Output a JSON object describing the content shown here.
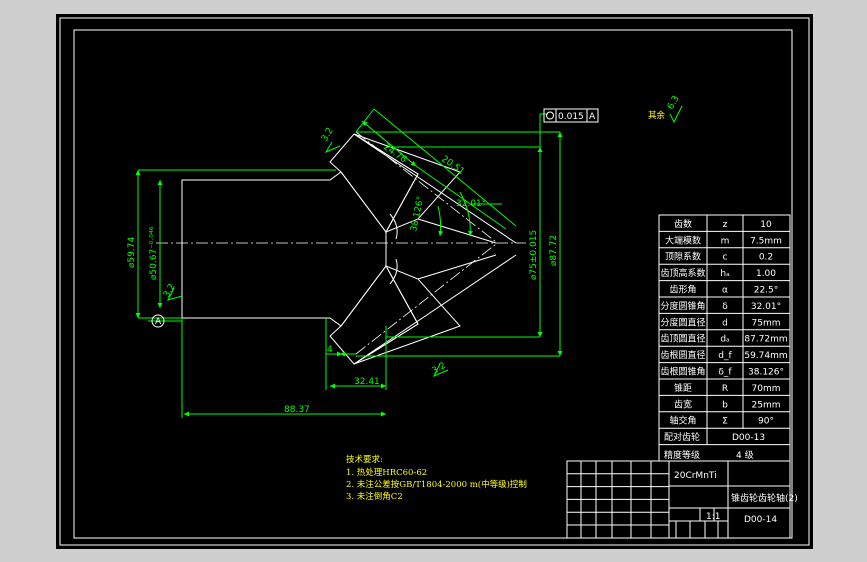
{
  "colors": {
    "sheet": "#000000",
    "outline": "#ffffff",
    "dimension": "#00ff00",
    "notes": "#ffff00"
  },
  "tolerance": {
    "symbol": "circular-runout",
    "value": "0.015",
    "datum": "A"
  },
  "roughness_note": {
    "label": "其余",
    "value": "6.3"
  },
  "dimensions": {
    "d1": "24.76",
    "d2": "20.51",
    "angle": "32.01°",
    "half_angle": "38.126°",
    "dia_root": "⌀59.74",
    "dia_bore": "⌀50.67⁻⁰·⁰⁴⁶",
    "dia_pitch": "⌀75±0.015",
    "dia_tip": "⌀87.72",
    "len_4": "4",
    "len_32": "32.41",
    "len_88": "88.37",
    "rough_a": "3.2",
    "rough_b": "3.2",
    "rough_c": "3.2",
    "datum_label": "A"
  },
  "param_table": [
    {
      "name": "齿数",
      "sym": "z",
      "val": "10"
    },
    {
      "name": "大端模数",
      "sym": "m",
      "val": "7.5mm"
    },
    {
      "name": "顶隙系数",
      "sym": "c",
      "val": "0.2"
    },
    {
      "name": "齿顶高系数",
      "sym": "hₐ",
      "val": "1.00"
    },
    {
      "name": "齿形角",
      "sym": "α",
      "val": "22.5°"
    },
    {
      "name": "分度圆锥角",
      "sym": "δ",
      "val": "32.01°"
    },
    {
      "name": "分度圆直径",
      "sym": "d",
      "val": "75mm"
    },
    {
      "name": "齿顶圆直径",
      "sym": "dₐ",
      "val": "87.72mm"
    },
    {
      "name": "齿根圆直径",
      "sym": "d_f",
      "val": "59.74mm"
    },
    {
      "name": "齿根圆锥角",
      "sym": "δ_f",
      "val": "38.126°"
    },
    {
      "name": "锥距",
      "sym": "R",
      "val": "70mm"
    },
    {
      "name": "齿宽",
      "sym": "b",
      "val": "25mm"
    },
    {
      "name": "轴交角",
      "sym": "Σ",
      "val": "90°"
    }
  ],
  "mating_gear": {
    "label": "配对齿轮",
    "val": "D00-13"
  },
  "accuracy": {
    "label": "精度等级",
    "val": "4 级"
  },
  "notes": {
    "title": "技术要求:",
    "lines": [
      "1. 热处理HRC60-62",
      "2. 未注公差按GB/T1804-2000 m(中等级)控制",
      "3. 未注倒角C2"
    ]
  },
  "title_block": {
    "material": "20CrMnTi",
    "part_name": "锥齿轮齿轮轴(2)",
    "code": "D00-14",
    "scale": "1:1"
  }
}
